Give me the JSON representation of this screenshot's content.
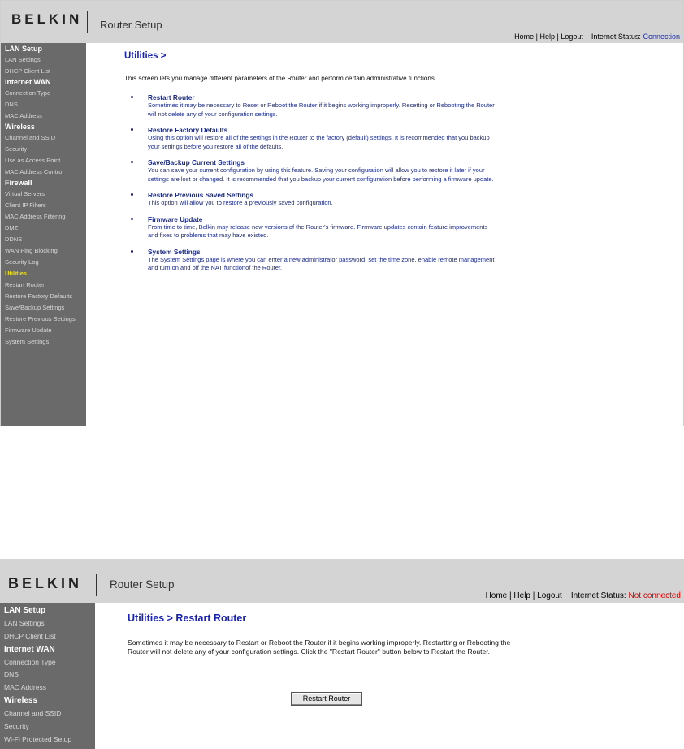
{
  "top": {
    "header": {
      "logo": "BELKIN",
      "app_title": "Router Setup",
      "links": {
        "home": "Home",
        "help": "Help",
        "logout": "Logout",
        "sep": "|"
      },
      "status_label": "Internet Status:",
      "status_value": "Connection"
    },
    "sidebar": [
      {
        "type": "head",
        "label": "LAN Setup"
      },
      {
        "type": "item",
        "label": "LAN Settings"
      },
      {
        "type": "item",
        "label": "DHCP Client List"
      },
      {
        "type": "head",
        "label": "Internet WAN"
      },
      {
        "type": "item",
        "label": "Connection Type"
      },
      {
        "type": "item",
        "label": "DNS"
      },
      {
        "type": "item",
        "label": "MAC Address"
      },
      {
        "type": "head",
        "label": "Wireless"
      },
      {
        "type": "item",
        "label": "Channel and SSID"
      },
      {
        "type": "item",
        "label": "Security"
      },
      {
        "type": "item",
        "label": "Use as Access Point"
      },
      {
        "type": "item",
        "label": "MAC Address Control"
      },
      {
        "type": "head",
        "label": "Firewall"
      },
      {
        "type": "item",
        "label": "Virtual Servers"
      },
      {
        "type": "item",
        "label": "Client IP Filters"
      },
      {
        "type": "item",
        "label": "MAC Address Filtering"
      },
      {
        "type": "item",
        "label": "DMZ"
      },
      {
        "type": "item",
        "label": "DDNS"
      },
      {
        "type": "item",
        "label": "WAN Ping Blocking"
      },
      {
        "type": "item",
        "label": "Security Log"
      },
      {
        "type": "active",
        "label": "Utilities"
      },
      {
        "type": "item",
        "label": "Restart Router"
      },
      {
        "type": "item",
        "label": "Restore Factory Defaults"
      },
      {
        "type": "item",
        "label": "Save/Backup Settings"
      },
      {
        "type": "item",
        "label": "Restore Previous Settings"
      },
      {
        "type": "item",
        "label": "Firmware Update"
      },
      {
        "type": "item",
        "label": "System Settings"
      }
    ],
    "main": {
      "title": "Utilities >",
      "intro": "This screen lets you manage different parameters of the Router and perform certain administrative functions.",
      "sections": [
        {
          "title": "Restart Router",
          "desc": "Sometimes it may be necessary to Reset or Reboot the Router if it begins working improperly. Resetting or Rebooting the Router will not delete any of your configuration settings."
        },
        {
          "title": "Restore Factory Defaults",
          "desc": "Using this option will restore all of the settings in the Router to the factory (default) settings. It is recommended that you backup your settings before you restore all of the defaults."
        },
        {
          "title": "Save/Backup Current Settings",
          "desc": "You can save your current configuration by using this feature. Saving your configuration will allow you to restore it later if your settings are lost or changed. It is recommended that you backup your current configuration before performing a firmware update."
        },
        {
          "title": "Restore Previous Saved Settings",
          "desc": "This option will allow you to restore a previously saved configuration."
        },
        {
          "title": "Firmware Update",
          "desc": "From time to time, Belkin may release new versions of the Router's firmware. Firmware updates contain feature improvements and fixes to problems that may have existed."
        },
        {
          "title": "System Settings",
          "desc": "The System Settings page is where you can enter a new administrator password, set the time zone, enable remote management and turn on and off the NAT functionof the Router."
        }
      ]
    }
  },
  "bottom": {
    "header": {
      "logo": "BELKIN",
      "app_title": "Router Setup",
      "links": {
        "home": "Home",
        "help": "Help",
        "logout": "Logout",
        "sep": "|"
      },
      "status_label": "Internet Status:",
      "status_value": "Not connected"
    },
    "sidebar": [
      {
        "type": "head",
        "label": "LAN Setup"
      },
      {
        "type": "item",
        "label": "LAN Settings"
      },
      {
        "type": "item",
        "label": "DHCP Client List"
      },
      {
        "type": "head",
        "label": "Internet WAN"
      },
      {
        "type": "item",
        "label": "Connection Type"
      },
      {
        "type": "item",
        "label": "DNS"
      },
      {
        "type": "item",
        "label": "MAC Address"
      },
      {
        "type": "head",
        "label": "Wireless"
      },
      {
        "type": "item",
        "label": "Channel and SSID"
      },
      {
        "type": "item",
        "label": "Security"
      },
      {
        "type": "item",
        "label": "Wi-Fi Protected Setup"
      }
    ],
    "main": {
      "title": "Utilities > Restart Router",
      "body": "Sometimes it may be necessary to Restart or Reboot the Router if it begins working improperly. Restartting or Rebooting the Router will not delete any of your configuration settings. Click the \"Restart Router\" button below to Restart the Router.",
      "button": "Restart Router"
    }
  }
}
